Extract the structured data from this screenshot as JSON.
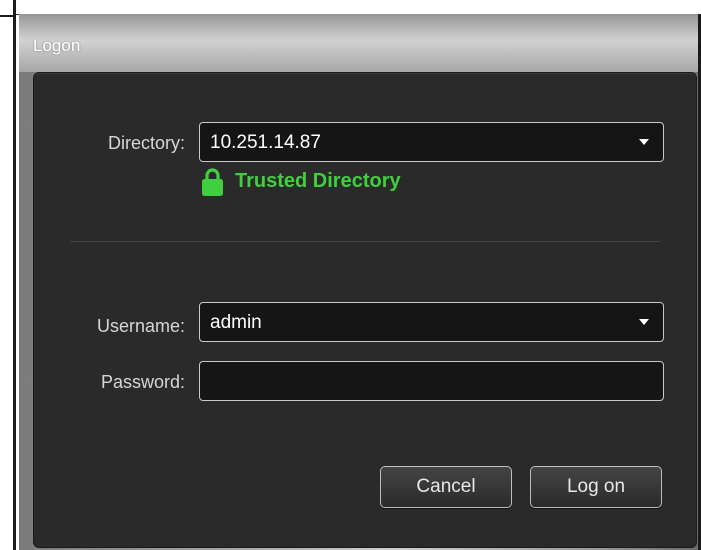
{
  "window": {
    "title": "Logon"
  },
  "directory": {
    "label": "Directory:",
    "value": "10.251.14.87",
    "status_text": "Trusted Directory",
    "status_color": "#3fcf3f",
    "status_icon": "lock-icon"
  },
  "username": {
    "label": "Username:",
    "value": "admin"
  },
  "password": {
    "label": "Password:",
    "value": ""
  },
  "buttons": {
    "cancel": "Cancel",
    "logon": "Log on"
  },
  "colors": {
    "panel_bg": "#2a2a2a",
    "field_bg": "#151515",
    "accent_green": "#3fcf3f"
  }
}
